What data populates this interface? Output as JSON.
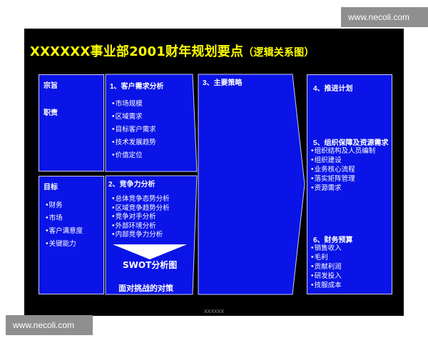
{
  "watermark": "www.necoli.com",
  "slide": {
    "title": "XXXXXX事业部2001财年规划要点",
    "subtitle": "（逻辑关系图）",
    "footer": "XXXXXX"
  },
  "boxes": {
    "purpose": {
      "label1": "宗旨",
      "label2": "职责"
    },
    "goals": {
      "title": "目标",
      "items": [
        "•财务",
        "•市场",
        "•客户满意度",
        "•关键能力"
      ]
    },
    "customer": {
      "title": "1、客户需求分析",
      "items": [
        "•市场规模",
        "•区域需求",
        "•目标客户需求",
        "•技术发展趋势",
        "•价值定位"
      ]
    },
    "competition": {
      "title": "2、竞争力分析",
      "items": [
        "•总体竞争态势分析",
        "•区域竞争趋势分析",
        "•竞争对手分析",
        "•外部环境分析",
        "•内部竞争力分析"
      ],
      "swot": "SWOT分析图",
      "response": "面对挑战的对策"
    },
    "strategy": {
      "title": "3、主要策略"
    },
    "plan": {
      "title": "4、推进计划",
      "org_title": "5、组织保障及资源需求",
      "org_items": [
        "•组织结构及人员编制",
        "•组织建设",
        "•业务核心流程",
        "•落实矩阵管理",
        "•资源需求"
      ],
      "budget_title": "6、财务预算",
      "budget_items": [
        "•销售收入",
        "•毛利",
        "•贡献利润",
        "•研发投入",
        "•技服成本"
      ]
    }
  },
  "colors": {
    "box": "#0a14e6",
    "title": "#ffff00",
    "background": "#000000"
  }
}
